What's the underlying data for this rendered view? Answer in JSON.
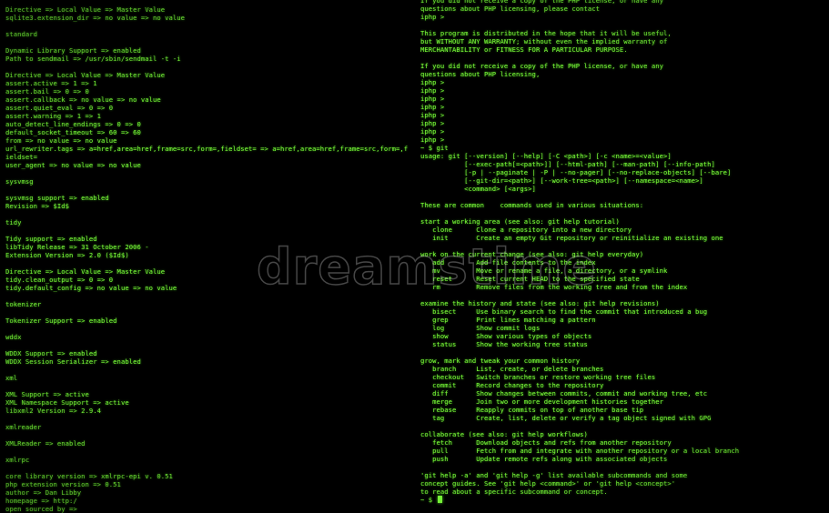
{
  "left_terminal": [
    "Directive => Local Value => Master Value",
    "sqlite3.extension_dir => no value => no value",
    "",
    "standard",
    "",
    "Dynamic Library Support => enabled",
    "Path to sendmail => /usr/sbin/sendmail -t -i",
    "",
    "Directive => Local Value => Master Value",
    "assert.active => 1 => 1",
    "assert.bail => 0 => 0",
    "assert.callback => no value => no value",
    "assert.quiet_eval => 0 => 0",
    "assert.warning => 1 => 1",
    "auto_detect_line_endings => 0 => 0",
    "default_socket_timeout => 60 => 60",
    "from => no value => no value",
    "url_rewriter.tags => a=href,area=href,frame=src,form=,fieldset= => a=href,area=href,frame=src,form=,f",
    "ieldset=",
    "user_agent => no value => no value",
    "",
    "sysvmsg",
    "",
    "sysvmsg support => enabled",
    "Revision => $Id$",
    "",
    "tidy",
    "",
    "Tidy support => enabled",
    "libTidy Release => 31 October 2006 -",
    "Extension Version => 2.0 ($Id$)",
    "",
    "Directive => Local Value => Master Value",
    "tidy.clean_output => 0 => 0",
    "tidy.default_config => no value => no value",
    "",
    "tokenizer",
    "",
    "Tokenizer Support => enabled",
    "",
    "wddx",
    "",
    "WDDX Support => enabled",
    "WDDX Session Serializer => enabled",
    "",
    "xml",
    "",
    "XML Support => active",
    "XML Namespace Support => active",
    "libxml2 Version => 2.9.4",
    "",
    "xmlreader",
    "",
    "XMLReader => enabled",
    "",
    "xmlrpc",
    "",
    "core library version => xmlrpc-epi v. 0.51",
    "php extension version => 0.51",
    "author => Dan Libby",
    "homepage => http:/",
    "open sourced by =>"
  ],
  "right_terminal": [
    "If you did not receive a copy of the PHP license, or have any",
    "questions about PHP licensing, please contact",
    "iphp >",
    "",
    "This program is distributed in the hope that it will be useful,",
    "but WITHOUT ANY WARRANTY; without even the implied warranty of",
    "MERCHANTABILITY or FITNESS FOR A PARTICULAR PURPOSE.",
    "",
    "If you did not receive a copy of the PHP license, or have any",
    "questions about PHP licensing,",
    "iphp >",
    "iphp >",
    "iphp >",
    "iphp >",
    "iphp >",
    "iphp >",
    "iphp >",
    "iphp >",
    "~ $ git",
    "usage: git [--version] [--help] [-C <path>] [-c <name>=<value>]",
    "           [--exec-path[=<path>]] [--html-path] [--man-path] [--info-path]",
    "           [-p | --paginate | -P | --no-pager] [--no-replace-objects] [--bare]",
    "           [--git-dir=<path>] [--work-tree=<path>] [--namespace=<name>]",
    "           <command> [<args>]",
    "",
    "These are common    commands used in various situations:",
    "",
    "start a working area (see also: git help tutorial)",
    "   clone      Clone a repository into a new directory",
    "   init       Create an empty Git repository or reinitialize an existing one",
    "",
    "work on the current change (see also: git help everyday)",
    "   add        Add file contents to the index",
    "   mv         Move or rename a file, a directory, or a symlink",
    "   reset      Reset current HEAD to the specified state",
    "   rm         Remove files from the working tree and from the index",
    "",
    "examine the history and state (see also: git help revisions)",
    "   bisect     Use binary search to find the commit that introduced a bug",
    "   grep       Print lines matching a pattern",
    "   log        Show commit logs",
    "   show       Show various types of objects",
    "   status     Show the working tree status",
    "",
    "grow, mark and tweak your common history",
    "   branch     List, create, or delete branches",
    "   checkout   Switch branches or restore working tree files",
    "   commit     Record changes to the repository",
    "   diff       Show changes between commits, commit and working tree, etc",
    "   merge      Join two or more development histories together",
    "   rebase     Reapply commits on top of another base tip",
    "   tag        Create, list, delete or verify a tag object signed with GPG",
    "",
    "collaborate (see also: git help workflows)",
    "   fetch      Download objects and refs from another repository",
    "   pull       Fetch from and integrate with another repository or a local branch",
    "   push       Update remote refs along with associated objects",
    "",
    "'git help -a' and 'git help -g' list available subcommands and some",
    "concept guides. See 'git help <command>' or 'git help <concept>'",
    "to read about a specific subcommand or concept.",
    "~ $"
  ],
  "watermark": "dreamstime",
  "colors": {
    "background": "#000000",
    "terminal_text": "#7dff3a"
  }
}
